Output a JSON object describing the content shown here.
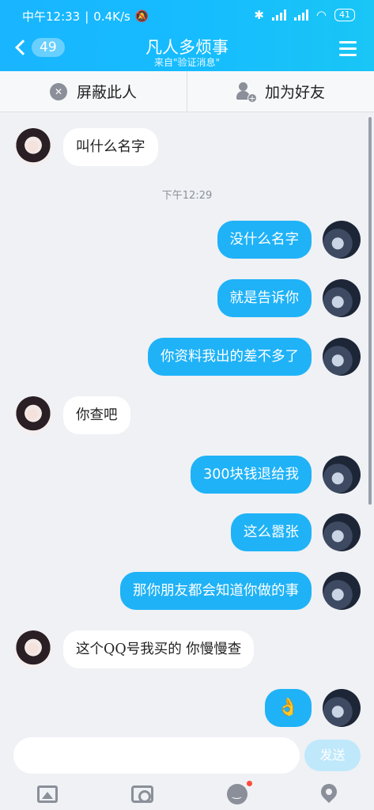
{
  "status_bar": {
    "time": "中午12:33",
    "speed": "0.4K/s",
    "battery": "41"
  },
  "header": {
    "back_count": "49",
    "title": "凡人多烦事",
    "subtitle": "来自\"验证消息\""
  },
  "actions": {
    "block_label": "屏蔽此人",
    "add_friend_label": "加为好友"
  },
  "timestamp": "下午12:29",
  "messages": [
    {
      "side": "in",
      "text": "叫什么名字"
    },
    {
      "side": "out",
      "text": "没什么名字"
    },
    {
      "side": "out",
      "text": "就是告诉你"
    },
    {
      "side": "out",
      "text": "你资料我出的差不多了"
    },
    {
      "side": "in",
      "text": "你查吧"
    },
    {
      "side": "out",
      "text": "300块钱退给我"
    },
    {
      "side": "out",
      "text": "这么嚣张"
    },
    {
      "side": "out",
      "text": "那你朋友都会知道你做的事"
    },
    {
      "side": "in",
      "text": "这个QQ号我买的 你慢慢查"
    },
    {
      "side": "out",
      "text": "👌"
    }
  ],
  "input": {
    "send_label": "发送"
  },
  "colors": {
    "header": "#16bcff",
    "out_bubble": "#1fb2f7",
    "background": "#eff1f5"
  },
  "icons": [
    "image-icon",
    "camera-icon",
    "emoji-icon",
    "location-icon"
  ]
}
